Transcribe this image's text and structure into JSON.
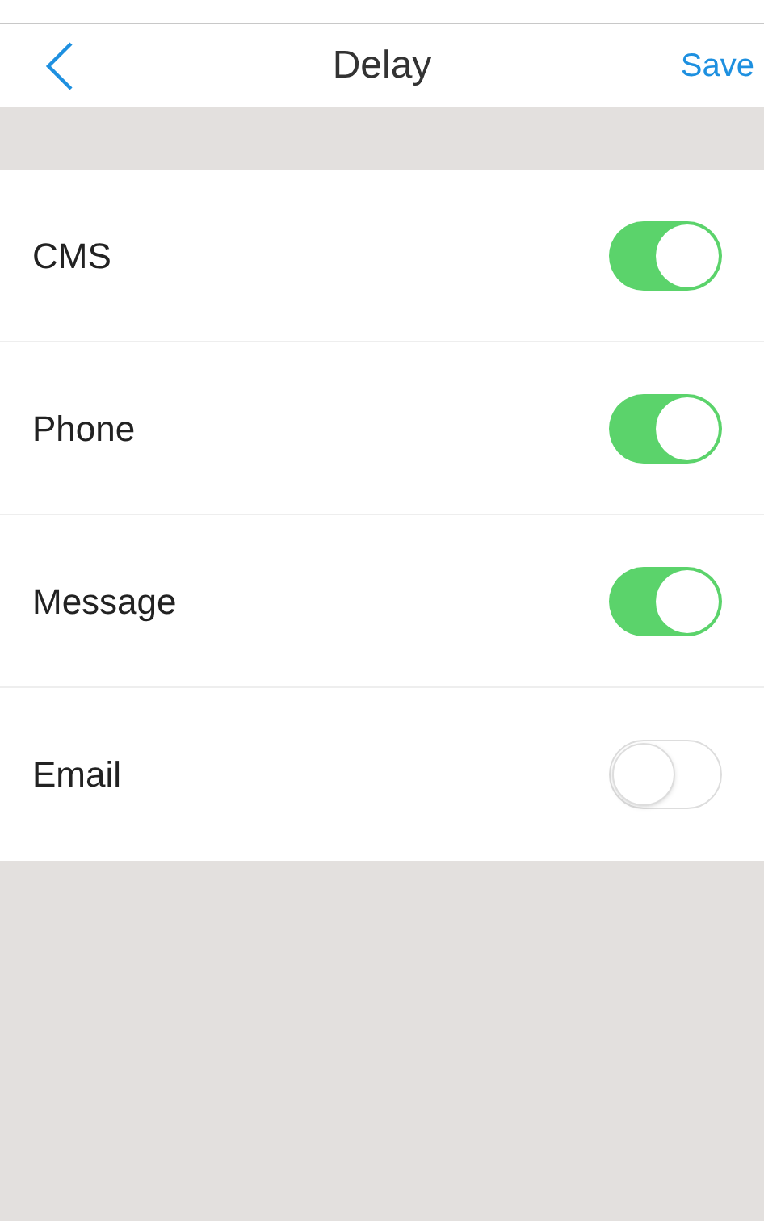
{
  "header": {
    "title": "Delay",
    "action": "Save"
  },
  "settings": [
    {
      "label": "CMS",
      "on": true
    },
    {
      "label": "Phone",
      "on": true
    },
    {
      "label": "Message",
      "on": true
    },
    {
      "label": "Email",
      "on": false
    }
  ]
}
